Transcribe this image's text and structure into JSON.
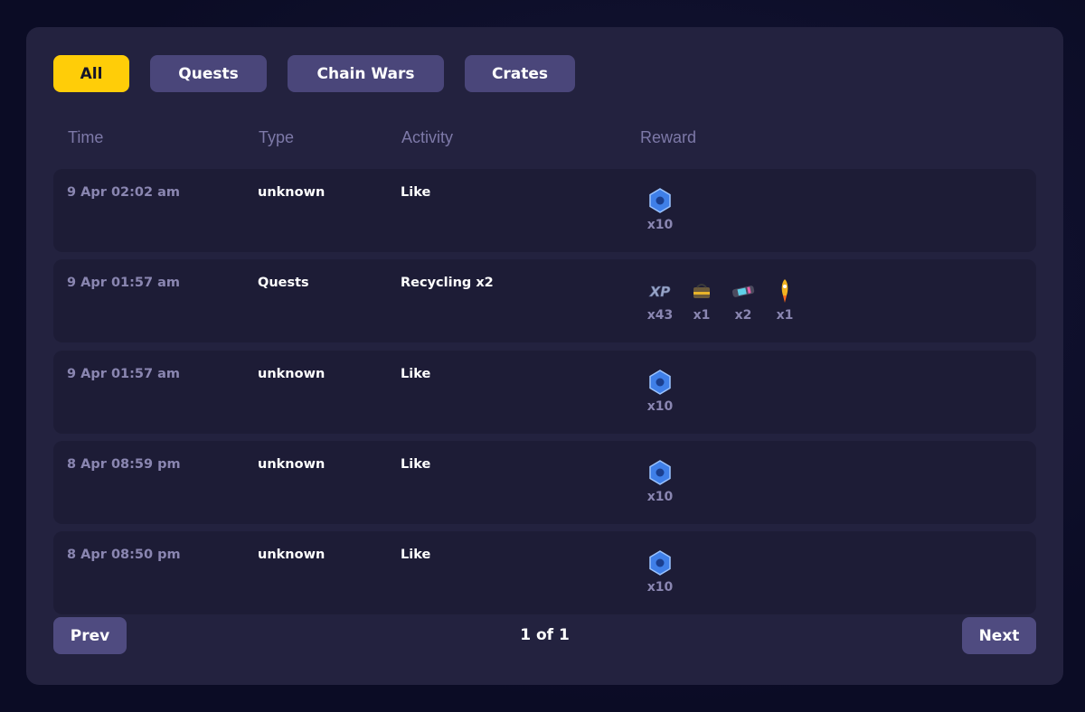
{
  "tabs": [
    {
      "label": "All",
      "active": true
    },
    {
      "label": "Quests",
      "active": false
    },
    {
      "label": "Chain Wars",
      "active": false
    },
    {
      "label": "Crates",
      "active": false
    }
  ],
  "table": {
    "headers": {
      "time": "Time",
      "type": "Type",
      "activity": "Activity",
      "reward": "Reward"
    },
    "rows": [
      {
        "time": "9 Apr 02:02 am",
        "type": "unknown",
        "activity": "Like",
        "rewards": [
          {
            "icon": "blue-gem-icon",
            "qty": "x10"
          }
        ]
      },
      {
        "time": "9 Apr 01:57 am",
        "type": "Quests",
        "activity": "Recycling x2",
        "rewards": [
          {
            "icon": "xp-icon",
            "qty": "x43"
          },
          {
            "icon": "crate-icon",
            "qty": "x1"
          },
          {
            "icon": "battery-icon",
            "qty": "x2"
          },
          {
            "icon": "rocket-icon",
            "qty": "x1"
          }
        ]
      },
      {
        "time": "9 Apr 01:57 am",
        "type": "unknown",
        "activity": "Like",
        "rewards": [
          {
            "icon": "blue-gem-icon",
            "qty": "x10"
          }
        ]
      },
      {
        "time": "8 Apr 08:59 pm",
        "type": "unknown",
        "activity": "Like",
        "rewards": [
          {
            "icon": "blue-gem-icon",
            "qty": "x10"
          }
        ]
      },
      {
        "time": "8 Apr 08:50 pm",
        "type": "unknown",
        "activity": "Like",
        "rewards": [
          {
            "icon": "blue-gem-icon",
            "qty": "x10"
          }
        ]
      }
    ]
  },
  "pagination": {
    "prev_label": "Prev",
    "next_label": "Next",
    "page_info": "1 of 1"
  },
  "colors": {
    "accent": "#ffcd08",
    "panel": "#23223f",
    "row": "#1d1c36",
    "button": "#4a467a"
  }
}
